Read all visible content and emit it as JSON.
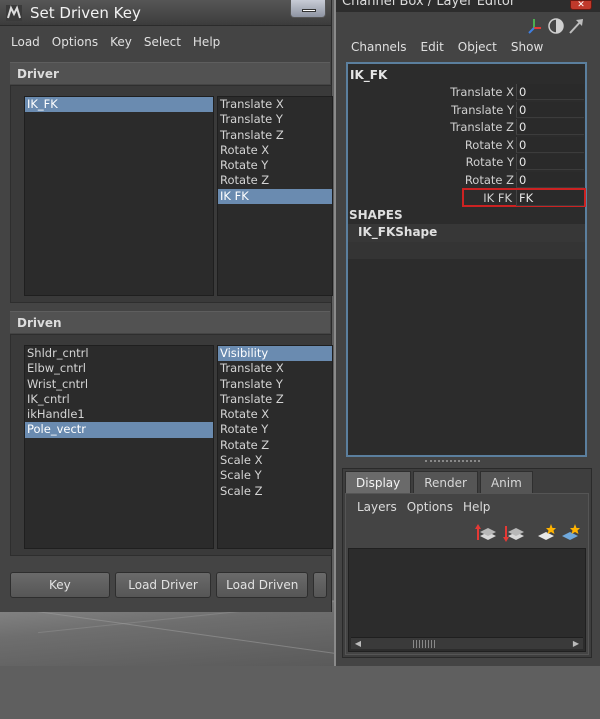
{
  "sdk": {
    "title": "Set Driven Key",
    "menu": [
      "Load",
      "Options",
      "Key",
      "Select",
      "Help"
    ],
    "driver": {
      "label": "Driver",
      "objects": [
        {
          "name": "IK_FK",
          "selected": true
        }
      ],
      "attributes": [
        {
          "name": "Translate X",
          "selected": false
        },
        {
          "name": "Translate Y",
          "selected": false
        },
        {
          "name": "Translate Z",
          "selected": false
        },
        {
          "name": "Rotate X",
          "selected": false
        },
        {
          "name": "Rotate Y",
          "selected": false
        },
        {
          "name": "Rotate Z",
          "selected": false
        },
        {
          "name": "IK FK",
          "selected": true
        }
      ]
    },
    "driven": {
      "label": "Driven",
      "objects": [
        {
          "name": "Shldr_cntrl",
          "selected": false
        },
        {
          "name": "Elbw_cntrl",
          "selected": false
        },
        {
          "name": "Wrist_cntrl",
          "selected": false
        },
        {
          "name": "IK_cntrl",
          "selected": false
        },
        {
          "name": "ikHandle1",
          "selected": false
        },
        {
          "name": "Pole_vectr",
          "selected": true
        }
      ],
      "attributes": [
        {
          "name": "Visibility",
          "selected": true
        },
        {
          "name": "Translate X",
          "selected": false
        },
        {
          "name": "Translate Y",
          "selected": false
        },
        {
          "name": "Translate Z",
          "selected": false
        },
        {
          "name": "Rotate X",
          "selected": false
        },
        {
          "name": "Rotate Y",
          "selected": false
        },
        {
          "name": "Rotate Z",
          "selected": false
        },
        {
          "name": "Scale X",
          "selected": false
        },
        {
          "name": "Scale Y",
          "selected": false
        },
        {
          "name": "Scale Z",
          "selected": false
        }
      ]
    },
    "buttons": [
      "Key",
      "Load Driver",
      "Load Driven",
      ""
    ]
  },
  "channel_box": {
    "title": "Channel Box / Layer Editor",
    "close_glyph": "✕",
    "menu": [
      "Channels",
      "Edit",
      "Object",
      "Show"
    ],
    "node_name": "IK_FK",
    "channels": [
      {
        "name": "Translate X",
        "value": "0"
      },
      {
        "name": "Translate Y",
        "value": "0"
      },
      {
        "name": "Translate Z",
        "value": "0"
      },
      {
        "name": "Rotate X",
        "value": "0"
      },
      {
        "name": "Rotate Y",
        "value": "0"
      },
      {
        "name": "Rotate Z",
        "value": "0"
      }
    ],
    "highlighted_channel": {
      "name": "IK FK",
      "value": "FK"
    },
    "shapes_label": "SHAPES",
    "shape_name": "IK_FKShape"
  },
  "layer_editor": {
    "tabs": [
      {
        "label": "Display",
        "active": true
      },
      {
        "label": "Render",
        "active": false
      },
      {
        "label": "Anim",
        "active": false
      }
    ],
    "menu": [
      "Layers",
      "Options",
      "Help"
    ]
  },
  "colors": {
    "selection": "#6a8bb0",
    "highlight_border": "#cc2222",
    "panel_border": "#5b7f9e"
  }
}
